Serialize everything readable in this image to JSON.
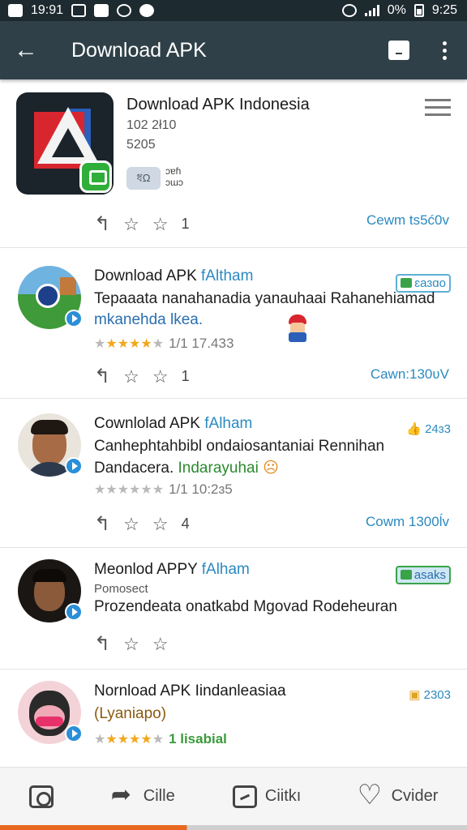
{
  "status_bar": {
    "time_left": "19:91",
    "right_text": "0%",
    "time_right": "9:25"
  },
  "app_bar": {
    "title": "Download APK"
  },
  "app_card": {
    "title": "Download APK Indonesia",
    "meta_1": "102 2ł10",
    "meta_2": "5205",
    "chip": "ধΩ",
    "chip_text": "ɔɐɦ\nɔɯɔ",
    "reply_count": "1",
    "download_link": "Cewm ts5ć0v"
  },
  "reviews": [
    {
      "name": "Download APK",
      "handle": "fAltham",
      "line1": "Tepaaata nanahanadia yanauhaai Rahanehiamad",
      "line2_hl": "mkanehda lkea.",
      "stars_on": 5,
      "stars_off": 1,
      "star_text": "1/1 17.433",
      "reply_count": "1",
      "download_link": "Cawn:130ʋV",
      "tag": "ɛaɜɑo"
    },
    {
      "name": "Cownlolad APK",
      "handle": "fAlham",
      "line1": "Canhephtahbibl ondaiosantaniai Rennihan",
      "line2": "Dandacera.",
      "line2_green": "Indarayuhai",
      "stars_on": 0,
      "stars_off": 6,
      "star_text": "1/1 10:2ɜ5",
      "reply_count": "4",
      "download_link": "Cowm 1300ĺv",
      "tag": "24ɜ3"
    },
    {
      "name": "Meonlod APPY",
      "handle": "fAlham",
      "line1": "Pomosect",
      "line2": "Prozendeata onatkabd Mgovad Rodeheuran",
      "tag": "asaks"
    },
    {
      "name": "Nornload APK Iindanleasiaa",
      "line1_brown": "(Lyaniapo)",
      "stars_on": 4,
      "stars_off": 2,
      "star_text": "1 lisabial",
      "tag": "2303"
    }
  ],
  "bottom_nav": [
    {
      "label": "",
      "icon": "camera-icon"
    },
    {
      "label": "Cille",
      "icon": "share-icon"
    },
    {
      "label": "Ciitkı",
      "icon": "edit-icon"
    },
    {
      "label": "Cvider",
      "icon": "heart-icon"
    }
  ]
}
